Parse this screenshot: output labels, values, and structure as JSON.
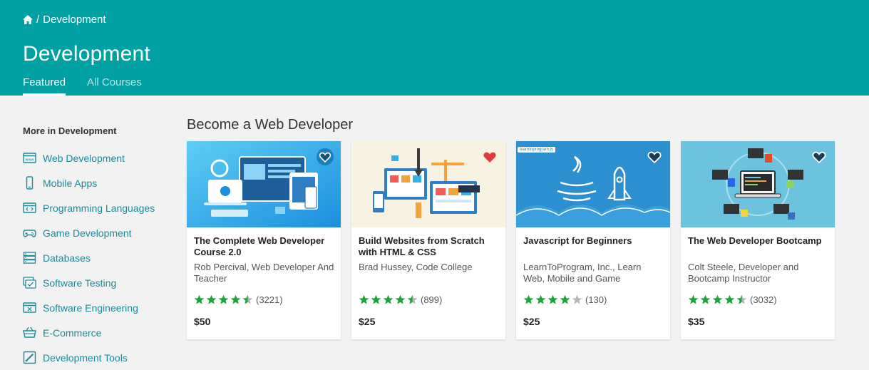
{
  "breadcrumb": {
    "home_icon": "home-icon",
    "separator": "/",
    "current": "Development"
  },
  "header": {
    "title": "Development"
  },
  "tabs": [
    {
      "label": "Featured"
    },
    {
      "label": "All Courses"
    }
  ],
  "colors": {
    "header": "#00a0a3",
    "link": "#1a8b9a",
    "star": "#1ea33a",
    "star_empty": "#b5b5b5",
    "heart_red": "#e23d3d"
  },
  "sidebar": {
    "title": "More in Development",
    "items": [
      {
        "label": "Web Development",
        "icon": "browser-icon"
      },
      {
        "label": "Mobile Apps",
        "icon": "mobile-phone-icon"
      },
      {
        "label": "Programming Languages",
        "icon": "code-window-icon"
      },
      {
        "label": "Game Development",
        "icon": "gamepad-icon"
      },
      {
        "label": "Databases",
        "icon": "database-icon"
      },
      {
        "label": "Software Testing",
        "icon": "testing-icon"
      },
      {
        "label": "Software Engineering",
        "icon": "engineering-icon"
      },
      {
        "label": "E-Commerce",
        "icon": "basket-icon"
      },
      {
        "label": "Development Tools",
        "icon": "tools-icon"
      }
    ]
  },
  "section": {
    "title": "Become a Web Developer"
  },
  "courses": [
    {
      "title": "The Complete Web Developer Course 2.0",
      "author": "Rob Percival, Web Developer And Teacher",
      "rating": 4.5,
      "count": "(3221)",
      "price": "$50",
      "wishlisted": "hover"
    },
    {
      "title": "Build Websites from Scratch with HTML & CSS",
      "author": "Brad Hussey, Code College",
      "rating": 4.5,
      "count": "(899)",
      "price": "$25",
      "wishlisted": "yes"
    },
    {
      "title": "Javascript for Beginners",
      "author": "LearnToProgram, Inc., Learn Web, Mobile and Game",
      "rating": 4,
      "count": "(130)",
      "price": "$25",
      "wishlisted": "no",
      "thumb_logo": "learntoprogram.tv"
    },
    {
      "title": "The Web Developer Bootcamp",
      "author": "Colt Steele, Developer and Bootcamp Instructor",
      "rating": 4.5,
      "count": "(3032)",
      "price": "$35",
      "wishlisted": "no"
    }
  ]
}
